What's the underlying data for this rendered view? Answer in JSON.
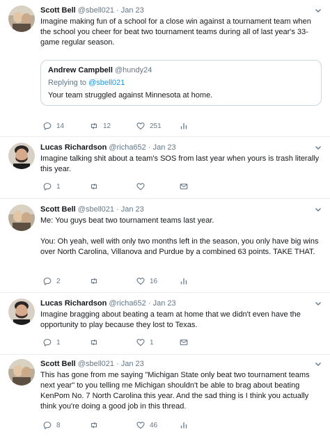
{
  "tweets": [
    {
      "name": "Scott Bell",
      "handle": "@sbell021",
      "sep": "·",
      "date": "Jan 23",
      "text": [
        "Imagine making fun of a school for a close win against a tournament team when the school you cheer for beat two tournament teams during all of last year's 33-game regular season."
      ],
      "quote": {
        "name": "Andrew Campbell",
        "handle": "@hundy24",
        "replying_label": "Replying to ",
        "replying_to": "@sbell021",
        "text": "Your team struggled against Minnesota at home."
      },
      "replies": "14",
      "retweets": "12",
      "likes": "251",
      "icons": [
        "reply-icon",
        "retweet-icon",
        "like-icon",
        "analytics-icon"
      ]
    },
    {
      "name": "Lucas Richardson",
      "handle": "@richa652",
      "sep": "·",
      "date": "Jan 23",
      "text": [
        "Imagine talking shit about a team's SOS from last year when yours is trash literally this year."
      ],
      "replies": "1",
      "retweets": "",
      "likes": "",
      "icons": [
        "reply-icon",
        "retweet-icon",
        "like-icon",
        "message-icon"
      ]
    },
    {
      "name": "Scott Bell",
      "handle": "@sbell021",
      "sep": "·",
      "date": "Jan 23",
      "text": [
        "Me: You guys beat two tournament teams last year.",
        "You: Oh yeah, well with only two months left in the season, you only have big wins over North Carolina, Villanova and Purdue by a combined 63 points. TAKE THAT."
      ],
      "replies": "2",
      "retweets": "",
      "likes": "16",
      "icons": [
        "reply-icon",
        "retweet-icon",
        "like-icon",
        "analytics-icon"
      ]
    },
    {
      "name": "Lucas Richardson",
      "handle": "@richa652",
      "sep": "·",
      "date": "Jan 23",
      "text": [
        "Imagine bragging about beating a team at home that we didn't even have the opportunity to play because they lost to Texas."
      ],
      "replies": "1",
      "retweets": "",
      "likes": "1",
      "icons": [
        "reply-icon",
        "retweet-icon",
        "like-icon",
        "message-icon"
      ]
    },
    {
      "name": "Scott Bell",
      "handle": "@sbell021",
      "sep": "·",
      "date": "Jan 23",
      "text": [
        "This has gone from me saying \"Michigan State only beat two tournament teams next year\" to you telling me Michigan shouldn't be able to brag about beating KenPom No. 7 North Carolina this year. And the sad thing is I think you actually think you're doing a good job in this thread."
      ],
      "replies": "8",
      "retweets": "",
      "likes": "46",
      "icons": [
        "reply-icon",
        "retweet-icon",
        "like-icon",
        "analytics-icon"
      ]
    }
  ],
  "colors": {
    "text": "#14171a",
    "muted": "#657786",
    "link": "#1b95e0",
    "border": "#e6ecf0"
  }
}
